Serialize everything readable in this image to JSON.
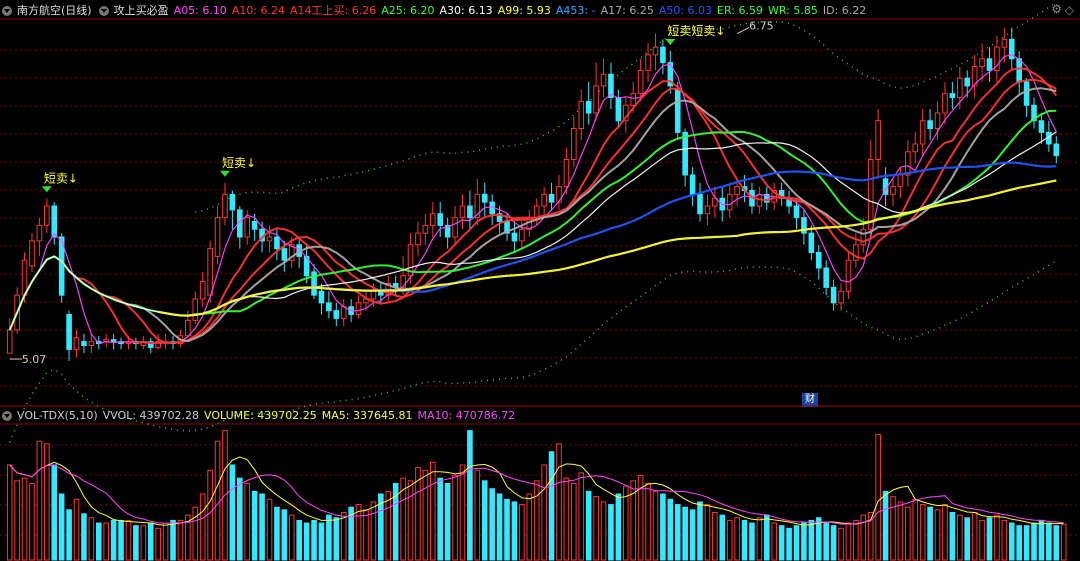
{
  "header": {
    "stock_name": "南方航空(日线)",
    "indicator_name": "攻上买必盈",
    "items": [
      {
        "label": "A05: 6.10",
        "color": "#ff44ff"
      },
      {
        "label": "A10: 6.24",
        "color": "#ff3333"
      },
      {
        "label": "A14工上买: 6.26",
        "color": "#ff3333"
      },
      {
        "label": "A25: 6.20",
        "color": "#33ff33"
      },
      {
        "label": "A30: 6.13",
        "color": "#ffffff"
      },
      {
        "label": "A99: 5.93",
        "color": "#ffff33"
      },
      {
        "label": "A453: -",
        "color": "#33aaff"
      },
      {
        "label": "A17: 6.25",
        "color": "#aaaaaa"
      },
      {
        "label": "A50: 6.03",
        "color": "#2255ff"
      },
      {
        "label": "ER: 6.59",
        "color": "#33ff33"
      },
      {
        "label": "WR: 5.85",
        "color": "#33ff33"
      },
      {
        "label": "ID: 6.22",
        "color": "#aaaaaa"
      }
    ]
  },
  "vol_header": {
    "items": [
      {
        "label": "VOL-TDX(5,10)",
        "color": "#cccccc"
      },
      {
        "label": "VVOL: 439702.28",
        "color": "#cccccc"
      },
      {
        "label": "VOLUME: 439702.25",
        "color": "#ffff33"
      },
      {
        "label": "MA5: 337645.81",
        "color": "#ffff33"
      },
      {
        "label": "MA10: 470786.72",
        "color": "#ff44ff"
      }
    ]
  },
  "badge": "财",
  "annotations": {
    "high_label": "6.75",
    "low_label": "5.07",
    "signal_label": "短卖↓",
    "signal_label_double": "短卖短卖↓"
  },
  "colors": {
    "up": "#ff3333",
    "down": "#33e8ff",
    "grid": "#8a0000"
  },
  "chart_data": [
    {
      "type": "candlestick",
      "price_range": [
        4.9,
        6.82
      ],
      "signals": [
        {
          "index": 5,
          "text": "短卖↓"
        },
        {
          "index": 29,
          "text": "短卖↓"
        },
        {
          "index": 89,
          "text": "短卖短卖↓"
        }
      ],
      "marks": [
        {
          "index": 0,
          "text": "5.07",
          "value": 5.07
        },
        {
          "index": 98,
          "text": "6.75",
          "value": 6.75
        }
      ],
      "candles": [
        [
          5.1,
          5.22,
          5.14,
          5.28
        ],
        [
          5.22,
          5.4,
          5.2,
          5.44
        ],
        [
          5.4,
          5.58,
          5.36,
          5.62
        ],
        [
          5.55,
          5.68,
          5.52,
          5.72
        ],
        [
          5.68,
          5.76,
          5.6,
          5.8
        ],
        [
          5.76,
          5.86,
          5.72,
          5.9
        ],
        [
          5.86,
          5.7,
          5.66,
          5.88
        ],
        [
          5.7,
          5.4,
          5.36,
          5.72
        ],
        [
          5.3,
          5.12,
          5.06,
          5.32
        ],
        [
          5.12,
          5.18,
          5.08,
          5.22
        ],
        [
          5.16,
          5.14,
          5.1,
          5.2
        ],
        [
          5.14,
          5.16,
          5.1,
          5.2
        ],
        [
          5.16,
          5.15,
          5.12,
          5.19
        ],
        [
          5.16,
          5.17,
          5.13,
          5.2
        ],
        [
          5.17,
          5.16,
          5.12,
          5.2
        ],
        [
          5.16,
          5.15,
          5.12,
          5.18
        ],
        [
          5.15,
          5.16,
          5.12,
          5.19
        ],
        [
          5.16,
          5.15,
          5.12,
          5.18
        ],
        [
          5.14,
          5.16,
          5.12,
          5.19
        ],
        [
          5.16,
          5.13,
          5.1,
          5.18
        ],
        [
          5.13,
          5.16,
          5.12,
          5.2
        ],
        [
          5.16,
          5.16,
          5.12,
          5.2
        ],
        [
          5.16,
          5.15,
          5.12,
          5.19
        ],
        [
          5.15,
          5.19,
          5.13,
          5.22
        ],
        [
          5.19,
          5.27,
          5.18,
          5.32
        ],
        [
          5.27,
          5.38,
          5.25,
          5.42
        ],
        [
          5.38,
          5.47,
          5.34,
          5.52
        ],
        [
          5.4,
          5.64,
          5.36,
          5.68
        ],
        [
          5.6,
          5.8,
          5.56,
          5.86
        ],
        [
          5.8,
          5.92,
          5.76,
          5.98
        ],
        [
          5.92,
          5.84,
          5.74,
          5.94
        ],
        [
          5.84,
          5.7,
          5.64,
          5.86
        ],
        [
          5.7,
          5.8,
          5.66,
          5.84
        ],
        [
          5.78,
          5.74,
          5.68,
          5.82
        ],
        [
          5.74,
          5.68,
          5.62,
          5.78
        ],
        [
          5.68,
          5.7,
          5.62,
          5.76
        ],
        [
          5.7,
          5.64,
          5.58,
          5.74
        ],
        [
          5.64,
          5.58,
          5.52,
          5.68
        ],
        [
          5.58,
          5.66,
          5.54,
          5.7
        ],
        [
          5.66,
          5.6,
          5.54,
          5.7
        ],
        [
          5.6,
          5.5,
          5.46,
          5.66
        ],
        [
          5.52,
          5.4,
          5.38,
          5.56
        ],
        [
          5.42,
          5.36,
          5.3,
          5.46
        ],
        [
          5.36,
          5.32,
          5.28,
          5.42
        ],
        [
          5.32,
          5.28,
          5.24,
          5.36
        ],
        [
          5.28,
          5.34,
          5.24,
          5.38
        ],
        [
          5.34,
          5.3,
          5.26,
          5.38
        ],
        [
          5.3,
          5.36,
          5.28,
          5.4
        ],
        [
          5.36,
          5.38,
          5.32,
          5.42
        ],
        [
          5.38,
          5.42,
          5.34,
          5.46
        ],
        [
          5.42,
          5.4,
          5.36,
          5.46
        ],
        [
          5.4,
          5.46,
          5.36,
          5.5
        ],
        [
          5.46,
          5.44,
          5.4,
          5.5
        ],
        [
          5.44,
          5.5,
          5.4,
          5.6
        ],
        [
          5.5,
          5.66,
          5.46,
          5.72
        ],
        [
          5.66,
          5.72,
          5.6,
          5.78
        ],
        [
          5.72,
          5.76,
          5.66,
          5.82
        ],
        [
          5.76,
          5.82,
          5.7,
          5.88
        ],
        [
          5.82,
          5.76,
          5.7,
          5.88
        ],
        [
          5.76,
          5.7,
          5.64,
          5.8
        ],
        [
          5.7,
          5.8,
          5.66,
          5.86
        ],
        [
          5.8,
          5.86,
          5.74,
          5.92
        ],
        [
          5.86,
          5.8,
          5.74,
          5.94
        ],
        [
          5.8,
          5.92,
          5.76,
          6.0
        ],
        [
          5.92,
          5.88,
          5.8,
          5.98
        ],
        [
          5.88,
          5.82,
          5.76,
          5.92
        ],
        [
          5.82,
          5.78,
          5.72,
          5.86
        ],
        [
          5.78,
          5.72,
          5.68,
          5.82
        ],
        [
          5.72,
          5.68,
          5.62,
          5.78
        ],
        [
          5.68,
          5.74,
          5.64,
          5.78
        ],
        [
          5.74,
          5.8,
          5.7,
          5.84
        ],
        [
          5.8,
          5.86,
          5.76,
          5.9
        ],
        [
          5.86,
          5.92,
          5.8,
          5.96
        ],
        [
          5.92,
          5.88,
          5.84,
          5.98
        ],
        [
          5.88,
          5.96,
          5.84,
          6.02
        ],
        [
          5.96,
          6.1,
          5.92,
          6.16
        ],
        [
          6.1,
          6.26,
          6.06,
          6.32
        ],
        [
          6.26,
          6.4,
          6.2,
          6.46
        ],
        [
          6.4,
          6.34,
          6.28,
          6.5
        ],
        [
          6.34,
          6.48,
          6.3,
          6.6
        ],
        [
          6.48,
          6.54,
          6.42,
          6.62
        ],
        [
          6.54,
          6.42,
          6.36,
          6.6
        ],
        [
          6.42,
          6.3,
          6.26,
          6.46
        ],
        [
          6.3,
          6.38,
          6.24,
          6.42
        ],
        [
          6.38,
          6.44,
          6.34,
          6.5
        ],
        [
          6.44,
          6.56,
          6.4,
          6.62
        ],
        [
          6.56,
          6.64,
          6.5,
          6.7
        ],
        [
          6.64,
          6.68,
          6.56,
          6.75
        ],
        [
          6.68,
          6.6,
          6.54,
          6.72
        ],
        [
          6.6,
          6.48,
          6.44,
          6.66
        ],
        [
          6.46,
          6.24,
          6.2,
          6.5
        ],
        [
          6.24,
          6.02,
          5.96,
          6.26
        ],
        [
          6.02,
          5.92,
          5.86,
          6.06
        ],
        [
          5.92,
          5.82,
          5.78,
          5.98
        ],
        [
          5.82,
          5.86,
          5.76,
          5.92
        ],
        [
          5.86,
          5.9,
          5.8,
          5.96
        ],
        [
          5.9,
          5.84,
          5.78,
          5.96
        ],
        [
          5.84,
          5.92,
          5.8,
          5.98
        ],
        [
          5.92,
          5.96,
          5.86,
          6.0
        ],
        [
          5.96,
          5.94,
          5.88,
          6.02
        ],
        [
          5.94,
          5.86,
          5.82,
          5.98
        ],
        [
          5.86,
          5.92,
          5.82,
          5.96
        ],
        [
          5.92,
          5.88,
          5.84,
          5.96
        ],
        [
          5.88,
          5.94,
          5.84,
          5.98
        ],
        [
          5.94,
          5.9,
          5.86,
          5.98
        ],
        [
          5.9,
          5.86,
          5.82,
          5.94
        ],
        [
          5.86,
          5.8,
          5.74,
          5.9
        ],
        [
          5.8,
          5.72,
          5.66,
          5.84
        ],
        [
          5.72,
          5.62,
          5.58,
          5.76
        ],
        [
          5.62,
          5.54,
          5.48,
          5.66
        ],
        [
          5.54,
          5.44,
          5.4,
          5.58
        ],
        [
          5.44,
          5.36,
          5.32,
          5.48
        ],
        [
          5.36,
          5.42,
          5.32,
          5.46
        ],
        [
          5.42,
          5.58,
          5.38,
          5.62
        ],
        [
          5.58,
          5.66,
          5.54,
          5.72
        ],
        [
          5.66,
          5.74,
          5.62,
          5.8
        ],
        [
          5.74,
          6.1,
          5.7,
          6.2
        ],
        [
          6.1,
          6.3,
          6.0,
          6.36
        ],
        [
          6.0,
          5.92,
          5.86,
          6.06
        ],
        [
          5.92,
          5.96,
          5.86,
          6.0
        ],
        [
          5.96,
          6.02,
          5.9,
          6.06
        ],
        [
          6.02,
          6.14,
          5.96,
          6.2
        ],
        [
          6.14,
          6.18,
          6.08,
          6.24
        ],
        [
          6.18,
          6.3,
          6.12,
          6.36
        ],
        [
          6.3,
          6.26,
          6.2,
          6.36
        ],
        [
          6.26,
          6.34,
          6.2,
          6.4
        ],
        [
          6.34,
          6.44,
          6.28,
          6.5
        ],
        [
          6.44,
          6.42,
          6.36,
          6.5
        ],
        [
          6.42,
          6.52,
          6.36,
          6.58
        ],
        [
          6.52,
          6.48,
          6.42,
          6.56
        ],
        [
          6.48,
          6.58,
          6.42,
          6.64
        ],
        [
          6.58,
          6.62,
          6.5,
          6.7
        ],
        [
          6.62,
          6.56,
          6.5,
          6.68
        ],
        [
          6.56,
          6.68,
          6.5,
          6.74
        ],
        [
          6.68,
          6.72,
          6.6,
          6.78
        ],
        [
          6.72,
          6.62,
          6.56,
          6.78
        ],
        [
          6.62,
          6.5,
          6.44,
          6.66
        ],
        [
          6.5,
          6.38,
          6.32,
          6.52
        ],
        [
          6.38,
          6.3,
          6.26,
          6.42
        ],
        [
          6.3,
          6.24,
          6.18,
          6.34
        ],
        [
          6.24,
          6.18,
          6.14,
          6.3
        ],
        [
          6.18,
          6.12,
          6.08,
          6.22
        ]
      ],
      "ma_series": [
        {
          "name": "A05",
          "color": "#ff44ff",
          "period": 5
        },
        {
          "name": "A10",
          "color": "#ff3333",
          "period": 10
        },
        {
          "name": "A14工上买",
          "color": "#ff3333",
          "period": 14
        },
        {
          "name": "A17",
          "color": "#aaaaaa",
          "period": 17
        },
        {
          "name": "A25",
          "color": "#33ff33",
          "period": 25
        },
        {
          "name": "A30",
          "color": "#ffffff",
          "period": 30
        },
        {
          "name": "A50",
          "color": "#2255ff",
          "period": 50
        },
        {
          "name": "A99",
          "color": "#ffff33",
          "period": 99
        }
      ]
    },
    {
      "type": "bar",
      "volume_range": [
        0,
        1
      ],
      "volumes": [
        0.72,
        0.6,
        0.62,
        0.58,
        0.9,
        0.88,
        0.72,
        0.5,
        0.38,
        0.46,
        0.35,
        0.32,
        0.28,
        0.28,
        0.3,
        0.3,
        0.3,
        0.26,
        0.26,
        0.28,
        0.24,
        0.28,
        0.3,
        0.3,
        0.34,
        0.4,
        0.5,
        0.68,
        0.9,
        0.98,
        0.72,
        0.62,
        0.58,
        0.52,
        0.5,
        0.46,
        0.4,
        0.38,
        0.34,
        0.3,
        0.28,
        0.3,
        0.28,
        0.34,
        0.32,
        0.36,
        0.4,
        0.42,
        0.38,
        0.44,
        0.5,
        0.52,
        0.58,
        0.62,
        0.6,
        0.7,
        0.68,
        0.74,
        0.62,
        0.58,
        0.64,
        0.72,
        0.98,
        0.68,
        0.6,
        0.54,
        0.5,
        0.46,
        0.44,
        0.42,
        0.5,
        0.6,
        0.72,
        0.82,
        0.88,
        0.62,
        0.58,
        0.66,
        0.52,
        0.48,
        0.44,
        0.42,
        0.5,
        0.56,
        0.6,
        0.64,
        0.58,
        0.52,
        0.5,
        0.46,
        0.42,
        0.4,
        0.38,
        0.44,
        0.42,
        0.36,
        0.34,
        0.3,
        0.32,
        0.3,
        0.28,
        0.32,
        0.34,
        0.28,
        0.26,
        0.24,
        0.26,
        0.28,
        0.3,
        0.32,
        0.28,
        0.26,
        0.24,
        0.28,
        0.3,
        0.34,
        0.36,
        0.95,
        0.52,
        0.48,
        0.44,
        0.4,
        0.46,
        0.42,
        0.4,
        0.38,
        0.42,
        0.36,
        0.34,
        0.32,
        0.36,
        0.3,
        0.32,
        0.34,
        0.3,
        0.28,
        0.26,
        0.26,
        0.28,
        0.3,
        0.28,
        0.26,
        0.27
      ]
    }
  ]
}
